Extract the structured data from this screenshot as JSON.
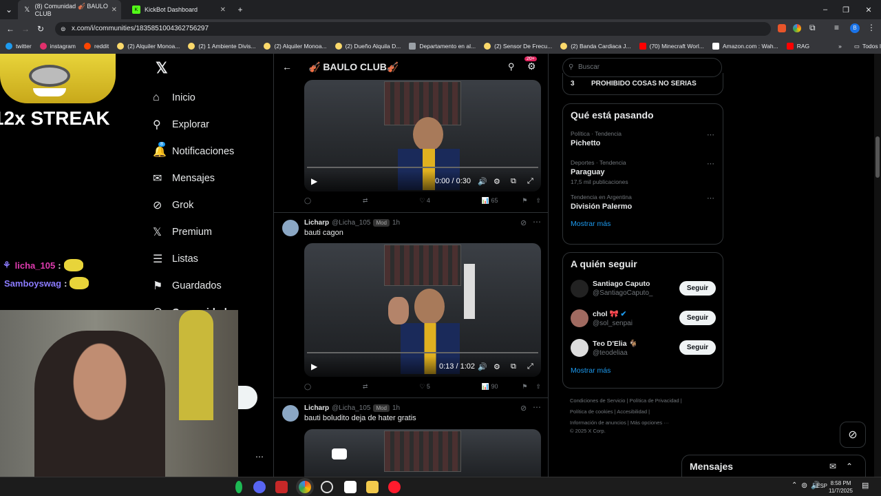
{
  "browser": {
    "tabs": [
      {
        "label": "(8) Comunidad 🎻 BAULO CLUB",
        "active": true
      },
      {
        "label": "KickBot Dashboard",
        "active": false
      }
    ],
    "url": "x.com/i/communities/1835851004362756297",
    "profile_initial": "B",
    "bookmarks": [
      "twitter",
      "instagram",
      "reddit",
      "(2) Alquiler Monoa...",
      "(2) 1 Ambiente Divis...",
      "(2) Alquiler Monoa...",
      "(2) Dueño Alquila D...",
      "Departamento en al...",
      "(2) Sensor De Frecu...",
      "(2) Banda Cardiaca J...",
      "(70) Minecraft Worl...",
      "Amazon.com : Wah...",
      "RAG"
    ],
    "all_bookmarks": "Todos los marcadores"
  },
  "stream": {
    "streak": "12x STREAK",
    "chat": [
      {
        "user": "licha_105",
        "color": "#e03bb0"
      },
      {
        "user": "Samboyswag",
        "color": "#8c7cff"
      }
    ]
  },
  "sidenav": {
    "items": [
      {
        "label": "Inicio",
        "icon": "home-icon"
      },
      {
        "label": "Explorar",
        "icon": "search-icon"
      },
      {
        "label": "Notificaciones",
        "icon": "bell-icon",
        "badge": "8"
      },
      {
        "label": "Mensajes",
        "icon": "mail-icon"
      },
      {
        "label": "Grok",
        "icon": "grok-icon"
      },
      {
        "label": "Premium",
        "icon": "x-icon"
      },
      {
        "label": "Listas",
        "icon": "list-icon"
      },
      {
        "label": "Guardados",
        "icon": "bookmark-icon"
      },
      {
        "label": "Comunidades",
        "icon": "communities-icon"
      }
    ]
  },
  "feed": {
    "title": "🎻 BAULO CLUB🎻",
    "notif_badge": "20+",
    "post0": {
      "time": "0:00 / 0:30",
      "likes": "4",
      "views": "65"
    },
    "post1": {
      "name": "Licharp",
      "handle": "@Licha_105",
      "mod": "Mod",
      "age": "1h",
      "text": "bauti cagon",
      "time": "0:13 / 1:02",
      "likes": "5",
      "views": "90"
    },
    "post2": {
      "name": "Licharp",
      "handle": "@Licha_105",
      "mod": "Mod",
      "age": "1h",
      "text": "bauti boludito deja de hater gratis"
    }
  },
  "right": {
    "search_placeholder": "Buscar",
    "rule": {
      "num": "3",
      "text": "PROHIBIDO COSAS NO SERIAS"
    },
    "trending_title": "Qué está pasando",
    "trends": [
      {
        "category": "Política · Tendencia",
        "name": "Pichetto",
        "sub": ""
      },
      {
        "category": "Deportes · Tendencia",
        "name": "Paraguay",
        "sub": "17,5 mil publicaciones"
      },
      {
        "category": "Tendencia en Argentina",
        "name": "División Palermo",
        "sub": ""
      }
    ],
    "show_more": "Mostrar más",
    "follow_title": "A quién seguir",
    "follow": [
      {
        "name": "Santiago Caputo",
        "handle": "@SantiagoCaputo_",
        "color": "#222"
      },
      {
        "name": "chol 🎀",
        "handle": "@sol_senpai",
        "color": "#a06a60"
      },
      {
        "name": "Teo D'Elia 🐐",
        "handle": "@teodeliaa",
        "color": "#ddd"
      }
    ],
    "follow_btn": "Seguir",
    "footer": [
      "Condiciones de Servicio",
      "Política de Privacidad",
      "Política de cookies",
      "Accesibilidad",
      "Información de anuncios",
      "Más opciones ···",
      "© 2025 X Corp."
    ],
    "messages": "Mensajes"
  },
  "taskbar": {
    "lang": "ESP",
    "time": "8:58 PM",
    "date": "11/7/2025"
  }
}
